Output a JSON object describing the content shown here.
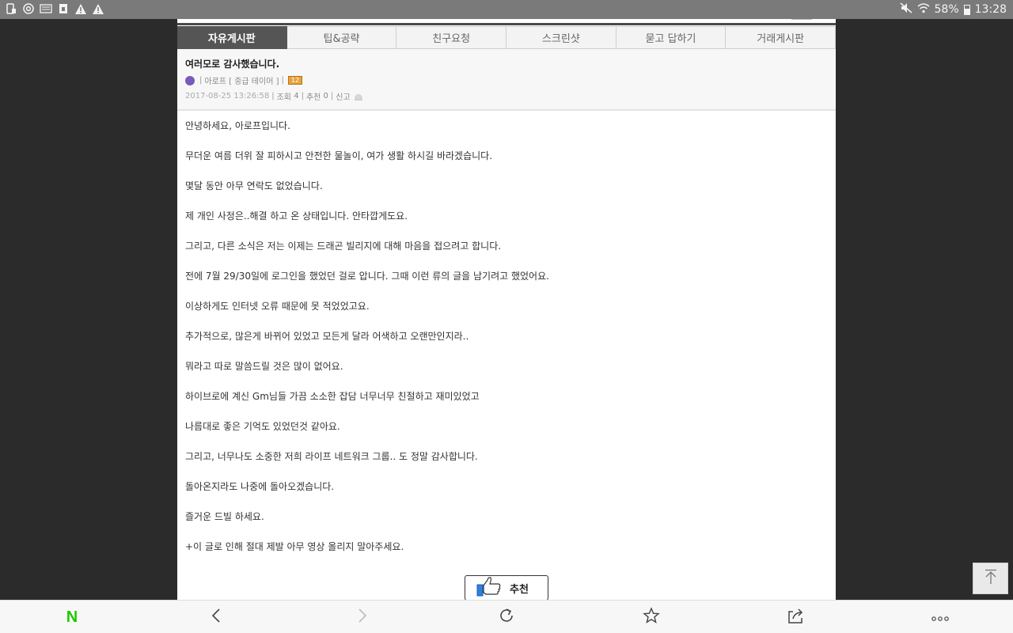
{
  "status_bar": {
    "battery_text": "58%",
    "battery_level": 0.58,
    "time": "13:28"
  },
  "tabs": [
    {
      "label": "자유게시판",
      "active": true
    },
    {
      "label": "팁&공략",
      "active": false
    },
    {
      "label": "친구요청",
      "active": false
    },
    {
      "label": "스크린샷",
      "active": false
    },
    {
      "label": "묻고 답하기",
      "active": false
    },
    {
      "label": "거래게시판",
      "active": false
    }
  ],
  "post": {
    "title": "여러모로 감사했습니다.",
    "author": "아로프 [ 중급 테이머 ]",
    "level_badge": "12",
    "date": "2017-08-25 13:26:58",
    "views_label": "조회",
    "views": "4",
    "recommend_label": "추천",
    "recommend_count": "0",
    "report_label": "신고",
    "paragraphs": [
      "안녕하세요, 아로프입니다.",
      "무더운 여름 더위 잘 피하시고 안전한 물놀이, 여가 생활 하시길 바라겠습니다.",
      "몇달 동안 아무 연락도 없었습니다.",
      "제 개인 사정은..해결 하고 온 상태입니다. 안타깝게도요.",
      "그리고, 다른 소식은 저는 이제는 드래곤 빌리지에 대해 마음을 접으려고 합니다.",
      "전에 7월 29/30일에 로그인을 했었던 걸로 압니다. 그때 이런 류의 글을 남기려고 했었어요.",
      "이상하게도 인터넷 오류 때문에 못 적었었고요.",
      "추가적으로, 많은게 바뀌어 있었고 모든게 달라 어색하고 오랜만인지라..",
      "뭐라고 따로 말씀드릴 것은 많이 없어요.",
      "하이브로에 계신 Gm님들 가끔 소소한 잡담 너무너무 친절하고 재미있었고",
      "나름대로 좋은 기억도 있었던것 같아요.",
      "그리고, 너무나도 소중한 저희 라이프 네트워크 그룹.. 도 정말 감사합니다.",
      "돌아온지라도 나중에 돌아오겠습니다.",
      "즐거운 드빌 하세요.",
      "+이 글로 인해 절대 제발 아무 영상 올리지 말아주세요."
    ],
    "recommend_button_label": "추천"
  },
  "bottom_nav": {
    "home_logo": "N"
  }
}
